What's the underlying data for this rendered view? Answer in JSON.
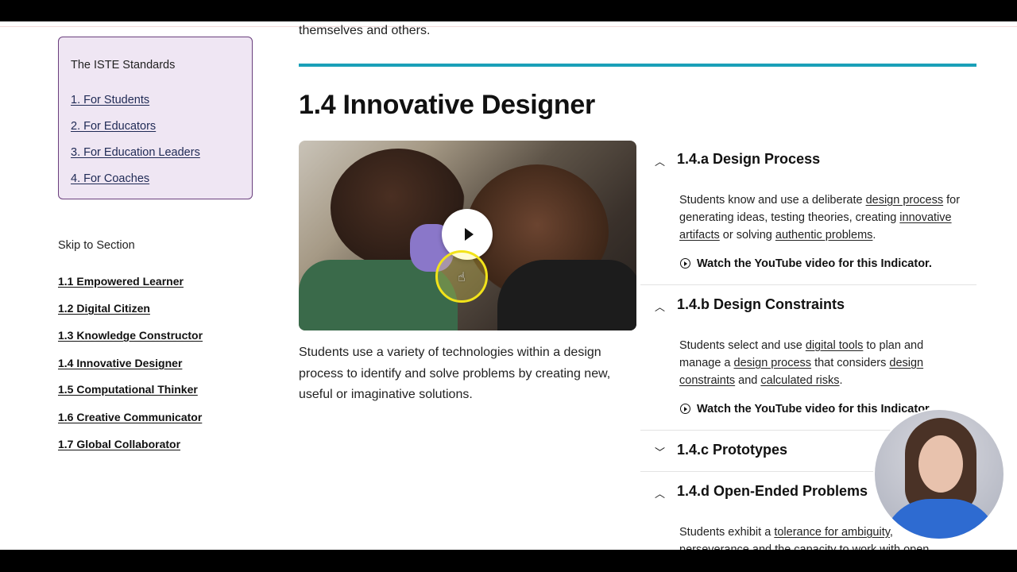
{
  "intro_tail": "themselves and others.",
  "sidebar": {
    "standards_title": "The ISTE Standards",
    "standards_links": [
      "1. For Students",
      "2. For Educators",
      "3. For Education Leaders",
      "4. For Coaches"
    ],
    "skip_title": "Skip to Section",
    "sections": [
      "1.1 Empowered Learner",
      "1.2 Digital Citizen",
      "1.3 Knowledge Constructor",
      "1.4 Innovative Designer",
      "1.5 Computational Thinker",
      "1.6 Creative Communicator",
      "1.7 Global Collaborator"
    ]
  },
  "main": {
    "title": "1.4 Innovative Designer",
    "description": "Students use a variety of technologies within a design process to identify and solve problems by creating new, useful or imaginative solutions."
  },
  "accordion": {
    "a": {
      "title": "1.4.a Design Process",
      "t1": "Students know and use a deliberate ",
      "l1": "design process",
      "t2": " for generating ideas, testing theories, creating ",
      "l2": "innovative artifacts",
      "t3": " or solving ",
      "l3": "authentic problems",
      "t4": ".",
      "watch": "Watch the YouTube video for this Indicator."
    },
    "b": {
      "title": "1.4.b Design Constraints",
      "t1": "Students select and use ",
      "l1": "digital tools",
      "t2": " to plan and manage a ",
      "l2": "design process",
      "t3": " that considers ",
      "l3": "design constraints",
      "t4": " and ",
      "l4": "calculated risks",
      "t5": ".",
      "watch": "Watch the YouTube video for this Indicator."
    },
    "c": {
      "title": "1.4.c Prototypes"
    },
    "d": {
      "title": "1.4.d Open-Ended Problems",
      "t1": "Students exhibit a ",
      "l1": "tolerance for ambiguity",
      "t2": ",",
      "t3": "perseverance and the capacity to work with open"
    }
  },
  "colors": {
    "accent_rule": "#1aa0b8",
    "sidebar_box_border": "#6a3f7d",
    "sidebar_box_bg": "#efe6f3"
  }
}
